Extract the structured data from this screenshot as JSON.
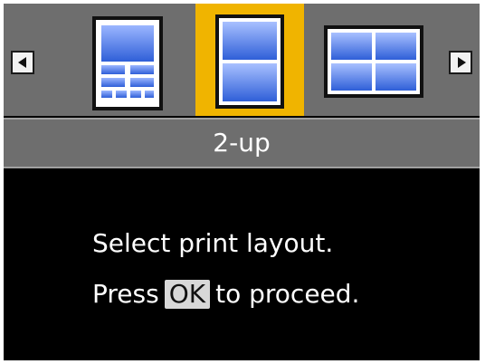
{
  "layout_selector": {
    "options": [
      {
        "icon": "layout-index-icon",
        "selected": false
      },
      {
        "icon": "layout-2-up-icon",
        "selected": true
      },
      {
        "icon": "layout-4-up-icon",
        "selected": false
      }
    ],
    "left_arrow_icon": "left-arrow-icon",
    "right_arrow_icon": "right-arrow-icon",
    "selected_label": "2-up"
  },
  "message": {
    "line1": "Select print layout.",
    "line2_before": "Press",
    "ok_key": "OK",
    "line2_after": "to proceed."
  },
  "colors": {
    "selection": "#f0b400",
    "toolbar": "#6e6e6e",
    "photo_blue": "#3f6fe0"
  }
}
